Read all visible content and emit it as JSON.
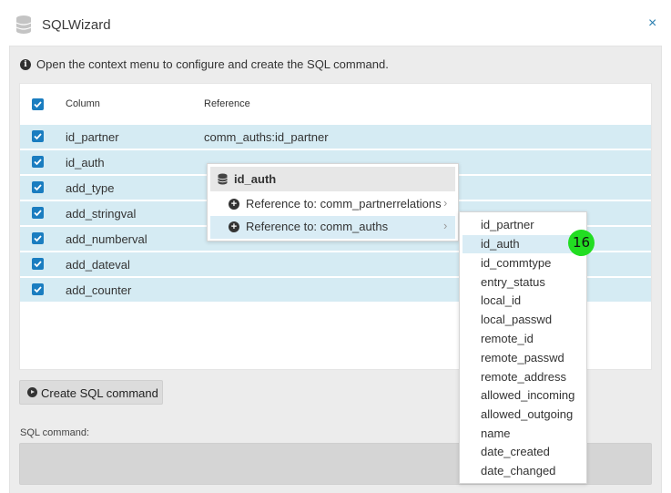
{
  "window": {
    "title": "SQLWizard",
    "close_glyph": "×"
  },
  "info": {
    "text": "Open the context menu to configure and create the SQL command."
  },
  "grid": {
    "headers": {
      "column": "Column",
      "reference": "Reference"
    },
    "rows": [
      {
        "column": "id_partner",
        "reference": "comm_auths:id_partner",
        "checked": true
      },
      {
        "column": "id_auth",
        "reference": "",
        "checked": true
      },
      {
        "column": "add_type",
        "reference": "",
        "checked": true
      },
      {
        "column": "add_stringval",
        "reference": "",
        "checked": true
      },
      {
        "column": "add_numberval",
        "reference": "",
        "checked": true
      },
      {
        "column": "add_dateval",
        "reference": "",
        "checked": true
      },
      {
        "column": "add_counter",
        "reference": "",
        "checked": true
      }
    ]
  },
  "buttons": {
    "create_sql": "Create SQL command"
  },
  "sql": {
    "label": "SQL command:",
    "value": ""
  },
  "context_menu": {
    "title": "id_auth",
    "items": [
      {
        "label": "Reference to: comm_partnerrelations",
        "chevron": "›"
      },
      {
        "label": "Reference to: comm_auths",
        "chevron": "›"
      }
    ]
  },
  "submenu": {
    "items": [
      "id_partner",
      "id_auth",
      "id_commtype",
      "entry_status",
      "local_id",
      "local_passwd",
      "remote_id",
      "remote_passwd",
      "remote_address",
      "allowed_incoming",
      "allowed_outgoing",
      "name",
      "date_created",
      "date_changed"
    ],
    "highlighted": "id_auth"
  },
  "badge": {
    "text": "16",
    "color": "#22dd22"
  },
  "colors": {
    "accent": "#1a7dc0",
    "row_selected": "#d5ebf3",
    "menu_hover": "#d9ecf5"
  }
}
